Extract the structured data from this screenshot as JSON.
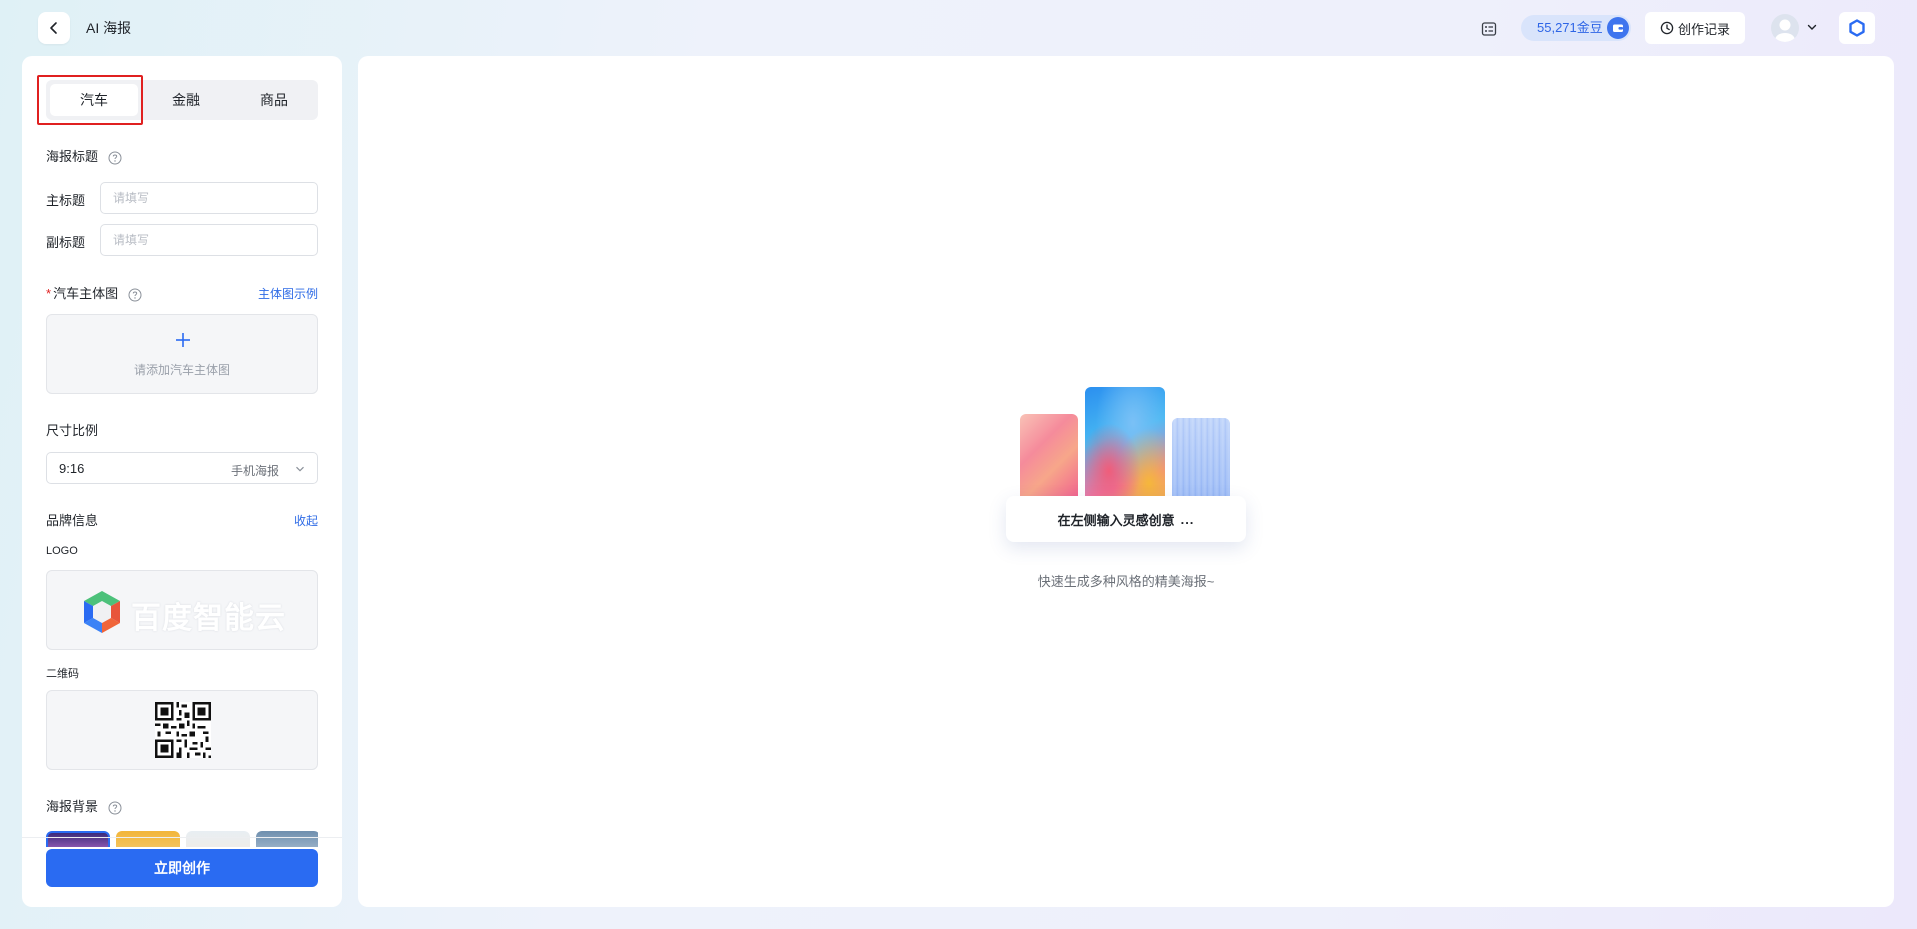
{
  "header": {
    "title": "AI 海报",
    "beans_label": "55,271金豆",
    "history_label": "创作记录"
  },
  "left_panel": {
    "tabs": [
      {
        "label": "汽车",
        "active": true
      },
      {
        "label": "金融",
        "active": false
      },
      {
        "label": "商品",
        "active": false
      }
    ],
    "poster_title_section": "海报标题",
    "main_title_label": "主标题",
    "main_title_placeholder": "请填写",
    "main_title_value": "",
    "sub_title_label": "副标题",
    "sub_title_placeholder": "请填写",
    "sub_title_value": "",
    "required_mark": "*",
    "car_image_label": "汽车主体图",
    "car_image_example_link": "主体图示例",
    "car_image_upload_hint": "请添加汽车主体图",
    "ratio_label": "尺寸比例",
    "ratio_value": "9:16",
    "ratio_desc": "手机海报",
    "brand_info_label": "品牌信息",
    "brand_collapse_link": "收起",
    "logo_label": "LOGO",
    "logo_text": "百度智能云",
    "qr_label": "二维码",
    "background_label": "海报背景",
    "create_button": "立即创作"
  },
  "main": {
    "prompt_pill_text": "在左侧输入灵感创意",
    "prompt_pill_dots": "...",
    "hint_text": "快速生成多种风格的精美海报~"
  },
  "colors": {
    "accent": "#2a6bf2",
    "highlight_border": "#e02020",
    "required": "#e02020"
  },
  "icons": {
    "back": "chevron-left-icon",
    "doc": "doc-list-icon",
    "wallet": "wallet-icon",
    "history": "clock-icon",
    "avatar": "user-avatar",
    "brand": "baidu-cloud-icon",
    "help": "question-circle-icon",
    "plus": "plus-icon",
    "caret": "chevron-down-icon"
  }
}
